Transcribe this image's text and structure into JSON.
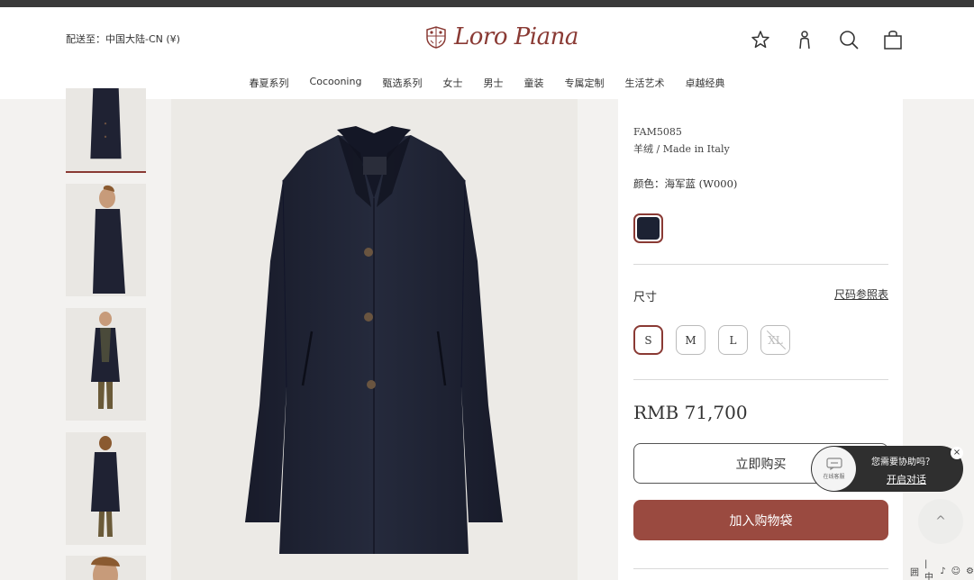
{
  "header": {
    "ship_to": "配送至：中国大陆-CN (¥)",
    "logo_text": "Loro Piana",
    "nav": [
      "春夏系列",
      "Cocooning",
      "甄选系列",
      "女士",
      "男士",
      "童装",
      "专属定制",
      "生活艺术",
      "卓越经典"
    ],
    "icons": [
      "star-icon",
      "user-icon",
      "search-icon",
      "shopping-bag-icon"
    ]
  },
  "product": {
    "sku": "FAM5085",
    "material": "羊绒 / Made in Italy",
    "color_label": "颜色：海军蓝 (W000)",
    "swatch_color": "#1c2233",
    "size_label": "尺寸",
    "size_guide": "尺码参照表",
    "sizes": [
      {
        "label": "S",
        "state": "selected"
      },
      {
        "label": "M",
        "state": "available"
      },
      {
        "label": "L",
        "state": "available"
      },
      {
        "label": "XL",
        "state": "unavailable"
      }
    ],
    "price": "RMB 71,700",
    "buy_now": "立即购买",
    "add_to_bag": "加入购物袋"
  },
  "chat": {
    "bubble_label": "在线客服",
    "question": "您需要协助吗？",
    "open": "开启对话",
    "close": "×"
  },
  "back_to_top": "^",
  "ime": [
    "囲",
    "|中",
    "♪",
    "☺",
    "⚙"
  ],
  "colors": {
    "accent": "#8a3a34",
    "bag_button": "#9a4a40",
    "coat": "#1f2233"
  }
}
